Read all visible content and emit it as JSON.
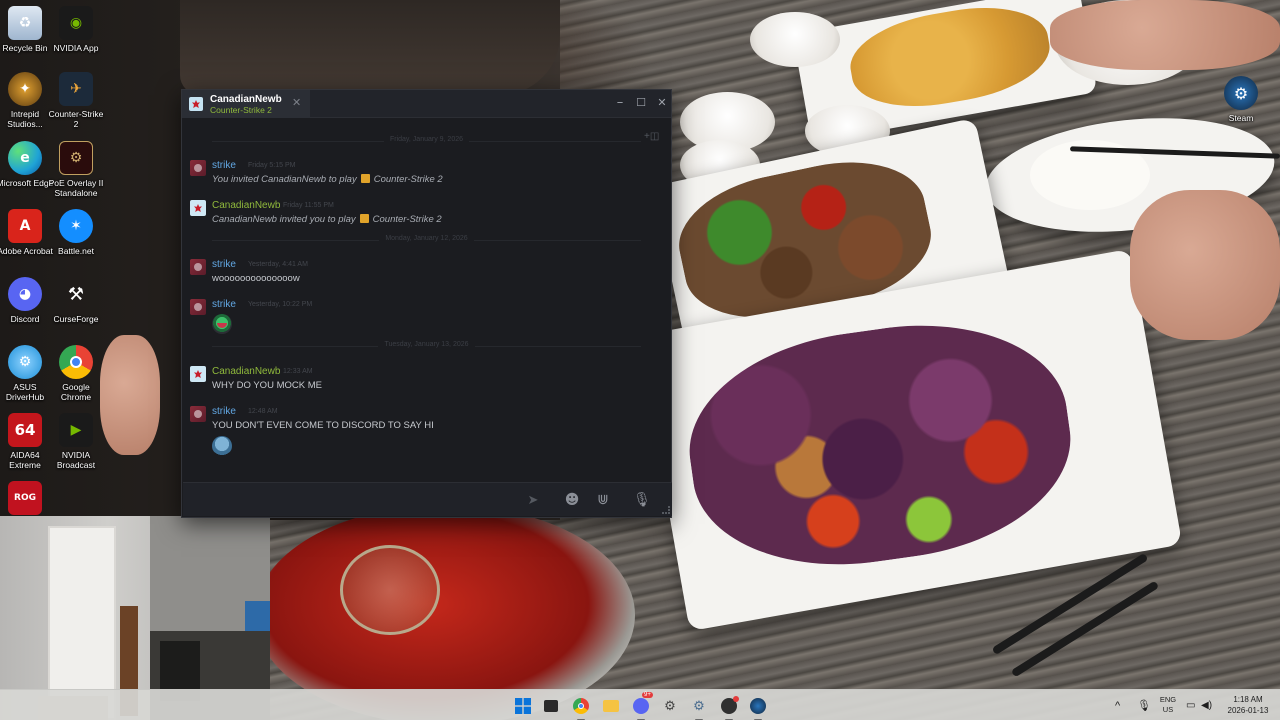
{
  "desktop": {
    "icons": [
      {
        "label": "Recycle Bin",
        "icon": "recycle-bin-icon",
        "color": "#4a90d9"
      },
      {
        "label": "NVIDIA App",
        "icon": "nvidia-icon",
        "color": "#76b900"
      },
      {
        "label": "Intrepid Studios...",
        "icon": "intrepid-icon",
        "color": "#b8860b"
      },
      {
        "label": "Counter-Strike 2",
        "icon": "counter-strike-icon",
        "color": "#f2a93b"
      },
      {
        "label": "Microsoft Edge",
        "icon": "edge-icon",
        "color": "#1fa3d6"
      },
      {
        "label": "PoE Overlay II Standalone",
        "icon": "poe-overlay-icon",
        "color": "#8b1a1a"
      },
      {
        "label": "Adobe Acrobat",
        "icon": "acrobat-icon",
        "color": "#d9241b"
      },
      {
        "label": "Battle.net",
        "icon": "battlenet-icon",
        "color": "#148eff"
      },
      {
        "label": "Discord",
        "icon": "discord-icon",
        "color": "#5865f2"
      },
      {
        "label": "CurseForge",
        "icon": "curseforge-icon",
        "color": "#333333"
      },
      {
        "label": "ASUS DriverHub",
        "icon": "asus-driverhub-icon",
        "color": "#1c8fd8"
      },
      {
        "label": "Google Chrome",
        "icon": "chrome-icon",
        "color": "#e94335"
      },
      {
        "label": "AIDA64 Extreme",
        "icon": "aida64-icon",
        "color": "#c4161c"
      },
      {
        "label": "NVIDIA Broadcast",
        "icon": "nvidia-broadcast-icon",
        "color": "#1a1a1a"
      },
      {
        "label": "",
        "icon": "rog-cpu-icon",
        "color": "#c1121f"
      }
    ],
    "steam_shortcut": {
      "label": "Steam",
      "icon": "steam-icon"
    }
  },
  "chat_window": {
    "tab": {
      "name": "CanadianNewb",
      "game": "Counter-Strike 2"
    },
    "controls": {
      "minimize": "–",
      "maximize": "☐",
      "close": "✕"
    },
    "days": [
      {
        "label": "Friday, January 9, 2026"
      },
      {
        "label": "Monday, January 12, 2026"
      },
      {
        "label": "Tuesday, January 13, 2026"
      }
    ],
    "messages": [
      {
        "sender": "strike",
        "time": "Friday 5:15 PM",
        "text": "You invited CanadianNewb to play",
        "game": "Counter-Strike 2"
      },
      {
        "sender": "CanadianNewb",
        "time": "Friday 11:55 PM",
        "text": "CanadianNewb invited you to play",
        "game": "Counter-Strike 2"
      },
      {
        "sender": "strike",
        "time": "Yesterday, 4:41 AM",
        "text": "woooooooooooooow"
      },
      {
        "sender": "strike",
        "time": "Yesterday, 10:22 PM",
        "emoticon": "green-emoticon"
      },
      {
        "sender": "CanadianNewb",
        "time": "12:33 AM",
        "text": "WHY DO YOU MOCK ME"
      },
      {
        "sender": "strike",
        "time": "12:48 AM",
        "text": "YOU DON'T EVEN COME TO DISCORD TO SAY HI",
        "emoticon": "blue-emoticon"
      }
    ],
    "input": {
      "value": "",
      "placeholder": ""
    },
    "colors": {
      "own_name": "#62a7e3",
      "friend_name": "#90ba3c",
      "background": "#1b1c20"
    }
  },
  "taskbar": {
    "apps": [
      "start",
      "terminal",
      "chrome",
      "file-explorer",
      "discord",
      "settings-gear",
      "settings",
      "obs",
      "steam"
    ],
    "discord_badge": "9+",
    "language": {
      "line1": "ENG",
      "line2": "US"
    },
    "clock": {
      "time": "1:18 AM",
      "date": "2026-01-13"
    }
  }
}
